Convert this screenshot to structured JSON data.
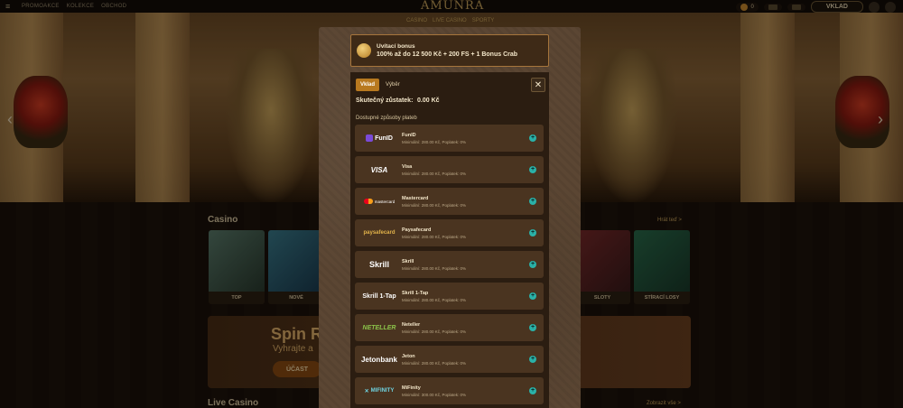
{
  "topbar": {
    "nav": [
      "PROMOAKCE",
      "KOLEKCE",
      "OBCHOD"
    ],
    "logo": "AMUNRA",
    "subnav": [
      "CASINO",
      "LIVE CASINO",
      "SPORTY"
    ],
    "coins": "0",
    "deposit": "VKLAD"
  },
  "site": {
    "casino_title": "Casino",
    "casino_link": "Hrát teď >",
    "tiles": [
      "TOP",
      "NOVÉ",
      "",
      "",
      "",
      "",
      "SLOTY",
      "STÍRACÍ LOSY"
    ],
    "promo_title": "Spin R",
    "promo_sub": "Vyhrajte a",
    "promo_btn": "ÚČAST",
    "live_title": "Live Casino",
    "live_link": "Zobrazit vše >"
  },
  "modal": {
    "bonus_title": "Uvítací bonus",
    "bonus_text": "100% až do 12 500 Kč + 200 FS + 1 Bonus Crab",
    "tab_deposit": "Vklad",
    "tab_withdraw": "Výběr",
    "close": "✕",
    "balance_label": "Skutečný zůstatek:",
    "balance_value": "0.00 Kč",
    "methods_heading": "Dostupné způsoby plateb",
    "methods": [
      {
        "logo": "FunID",
        "name": "FunID",
        "details": "Minimální: 280.00 Kč, Poplatek: 0%"
      },
      {
        "logo": "VISA",
        "name": "Visa",
        "details": "Minimální: 280.00 Kč, Poplatek: 0%"
      },
      {
        "logo": "mastercard",
        "name": "Mastercard",
        "details": "Minimální: 280.00 Kč, Poplatek: 0%"
      },
      {
        "logo": "paysafecard",
        "name": "Paysafecard",
        "details": "Minimální: 280.00 Kč, Poplatek: 0%"
      },
      {
        "logo": "Skrill",
        "name": "Skrill",
        "details": "Minimální: 280.00 Kč, Poplatek: 0%"
      },
      {
        "logo": "Skrill 1-Tap",
        "name": "Skrill 1-Tap",
        "details": "Minimální: 280.00 Kč, Poplatek: 0%"
      },
      {
        "logo": "NETELLER",
        "name": "Neteller",
        "details": "Minimální: 280.00 Kč, Poplatek: 0%"
      },
      {
        "logo": "Jetonbank",
        "name": "Jeton",
        "details": "Minimální: 280.00 Kč, Poplatek: 0%"
      },
      {
        "logo": "MIFINITY",
        "name": "MiFinity",
        "details": "Minimální: 300.00 Kč, Poplatek: 0%"
      }
    ]
  },
  "colors": {
    "accent": "#b8791f",
    "plus": "#2ab1a8",
    "panel": "#2b1d11",
    "row": "#4a3420"
  }
}
